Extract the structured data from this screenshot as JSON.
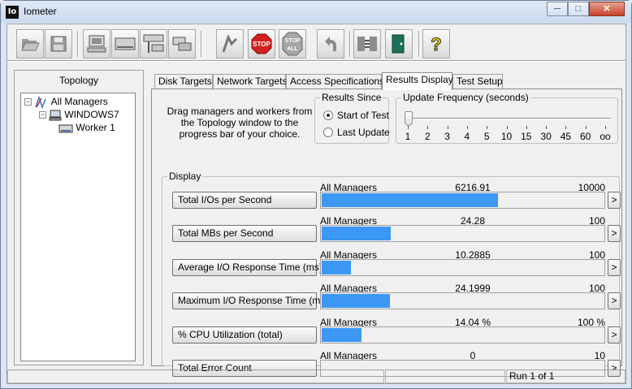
{
  "window": {
    "app_icon_text": "Io",
    "title": "Iometer",
    "minimize_glyph": "─",
    "maximize_glyph": "□",
    "close_glyph": "✕"
  },
  "toolbar": {
    "buttons": [
      {
        "name": "open-config",
        "icon": "folder-open-icon"
      },
      {
        "name": "save-config",
        "icon": "floppy-disk-icon"
      },
      {
        "name": "start-new-manager",
        "icon": "computer-icon"
      },
      {
        "name": "start-new-worker",
        "icon": "disk-worker-icon"
      },
      {
        "name": "start-network-worker",
        "icon": "network-worker-icon"
      },
      {
        "name": "duplicate-worker",
        "icon": "duplicate-icon"
      },
      {
        "name": "start-tests",
        "icon": "green-flag-icon"
      },
      {
        "name": "stop",
        "icon": "stop-sign-icon",
        "label": "STOP"
      },
      {
        "name": "stop-all",
        "icon": "stop-all-icon",
        "label": "STOP",
        "sublabel": "ALL"
      },
      {
        "name": "reset-workers",
        "icon": "undo-arrow-icon"
      },
      {
        "name": "disconnect-manager",
        "icon": "disconnect-icon"
      },
      {
        "name": "exit",
        "icon": "exit-door-icon"
      },
      {
        "name": "about",
        "icon": "question-mark-icon",
        "label": "?"
      }
    ]
  },
  "topology": {
    "title": "Topology",
    "expander_minus": "−",
    "items": [
      {
        "label": "All Managers",
        "level": 0
      },
      {
        "label": "WINDOWS7",
        "level": 1
      },
      {
        "label": "Worker 1",
        "level": 2
      }
    ]
  },
  "tabs": [
    {
      "label": "Disk Targets",
      "active": false
    },
    {
      "label": "Network Targets",
      "active": false
    },
    {
      "label": "Access Specifications",
      "active": false
    },
    {
      "label": "Results Display",
      "active": true
    },
    {
      "label": "Test Setup",
      "active": false
    }
  ],
  "results": {
    "instructions": "Drag managers and workers from the Topology window to the progress bar of your choice.",
    "results_since": {
      "legend": "Results Since",
      "options": [
        {
          "label": "Start of Test",
          "selected": true
        },
        {
          "label": "Last Update",
          "selected": false
        }
      ]
    },
    "update_frequency": {
      "legend": "Update Frequency (seconds)",
      "ticks": [
        "1",
        "2",
        "3",
        "4",
        "5",
        "10",
        "15",
        "30",
        "45",
        "60",
        "oo"
      ],
      "selected_index": 0
    },
    "display_legend": "Display",
    "expand_glyph": ">",
    "metrics": [
      {
        "button": "Total I/Os per Second",
        "manager": "All Managers",
        "value": "6216.91",
        "max": "10000",
        "fraction": 0.6217
      },
      {
        "button": "Total MBs per Second",
        "manager": "All Managers",
        "value": "24.28",
        "max": "100",
        "fraction": 0.2428
      },
      {
        "button": "Average I/O Response Time (ms)",
        "manager": "All Managers",
        "value": "10.2885",
        "max": "100",
        "fraction": 0.1029
      },
      {
        "button": "Maximum I/O Response Time (ms)",
        "manager": "All Managers",
        "value": "24.1999",
        "max": "100",
        "fraction": 0.242
      },
      {
        "button": "% CPU Utilization (total)",
        "manager": "All Managers",
        "value": "14.04 %",
        "max": "100 %",
        "fraction": 0.1404
      },
      {
        "button": "Total Error Count",
        "manager": "All Managers",
        "value": "0",
        "max": "10",
        "fraction": 0.0
      }
    ]
  },
  "status": {
    "run": "Run 1 of 1"
  },
  "colors": {
    "bar_fill": "#3c97f5",
    "stop_red": "#d42020"
  }
}
